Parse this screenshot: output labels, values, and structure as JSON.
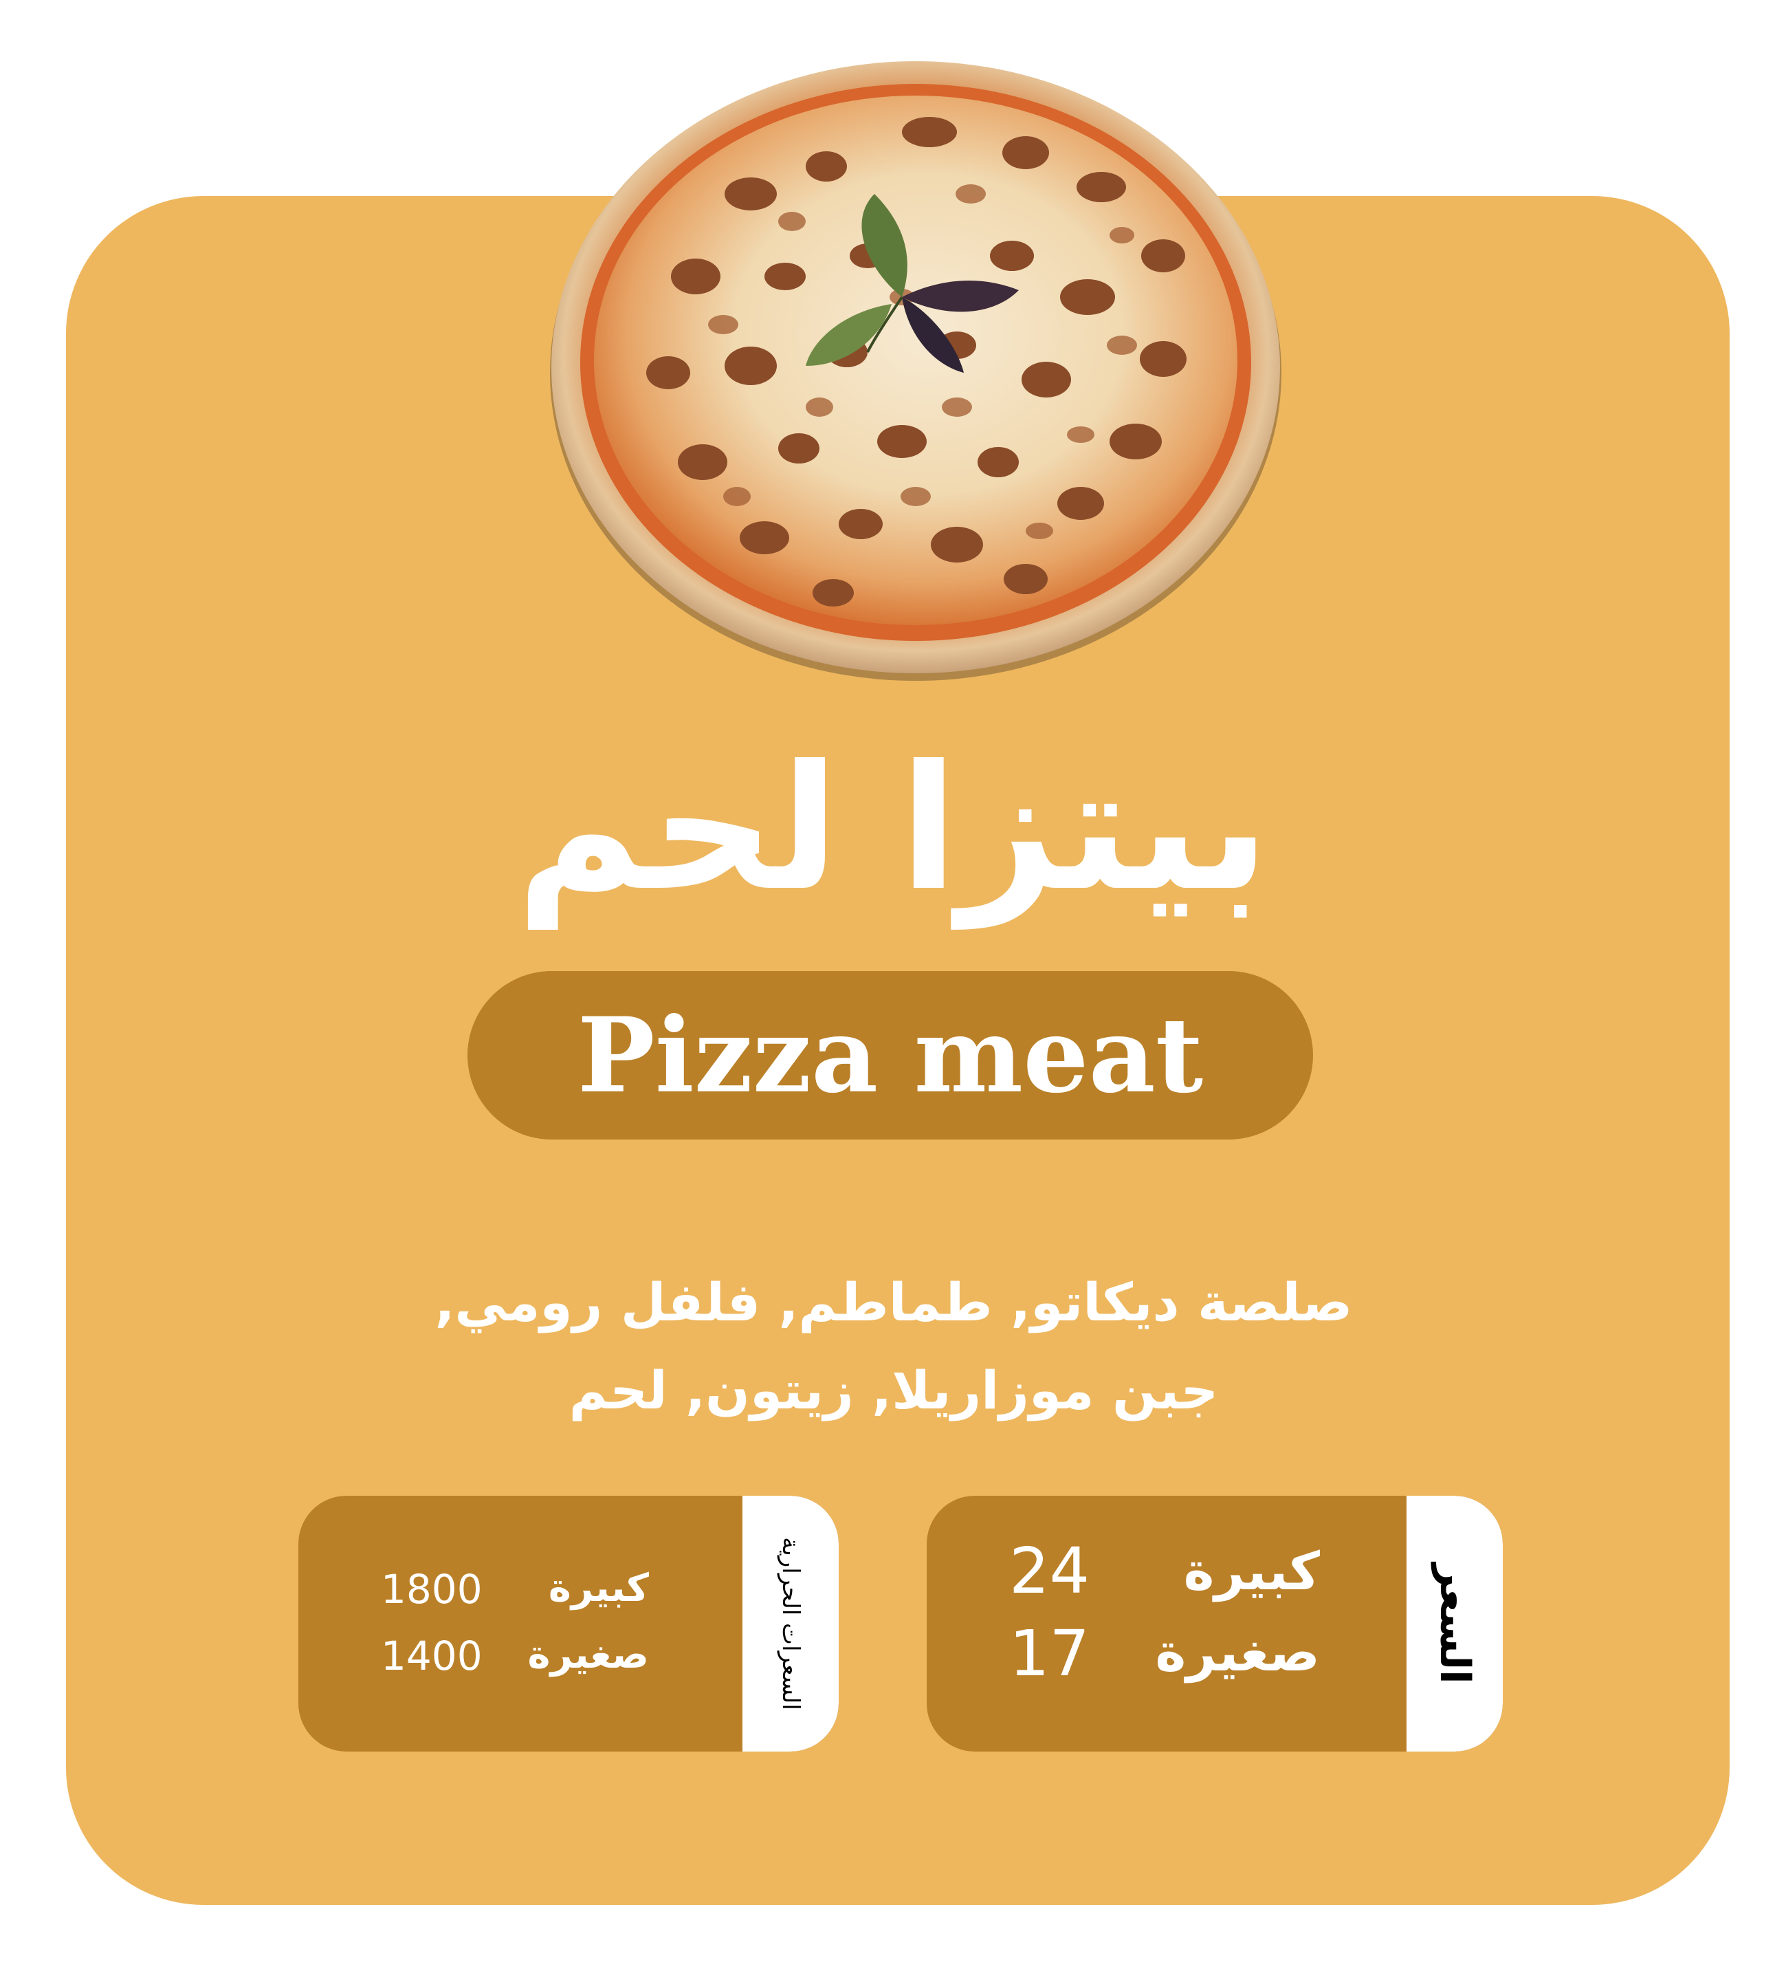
{
  "product": {
    "name_ar": "بيتزا لحم",
    "name_en": "Pizza meat",
    "ingredients_line1": "صلصة ديكاتو, طماطم, فلفل رومي,",
    "ingredients_line2": "جبن موزاريلا, زيتون, لحم"
  },
  "price": {
    "label": "السعر",
    "large_label": "كبيرة",
    "large_value": "24",
    "small_label": "صغيرة",
    "small_value": "17"
  },
  "calories": {
    "label": "السعرات الحرارية",
    "large_label": "كبيرة",
    "large_value": "1800",
    "small_label": "صغيرة",
    "small_value": "1400"
  },
  "colors": {
    "card": "#EEB75E",
    "accent": "#BA8028",
    "text": "#FFFFFF"
  }
}
